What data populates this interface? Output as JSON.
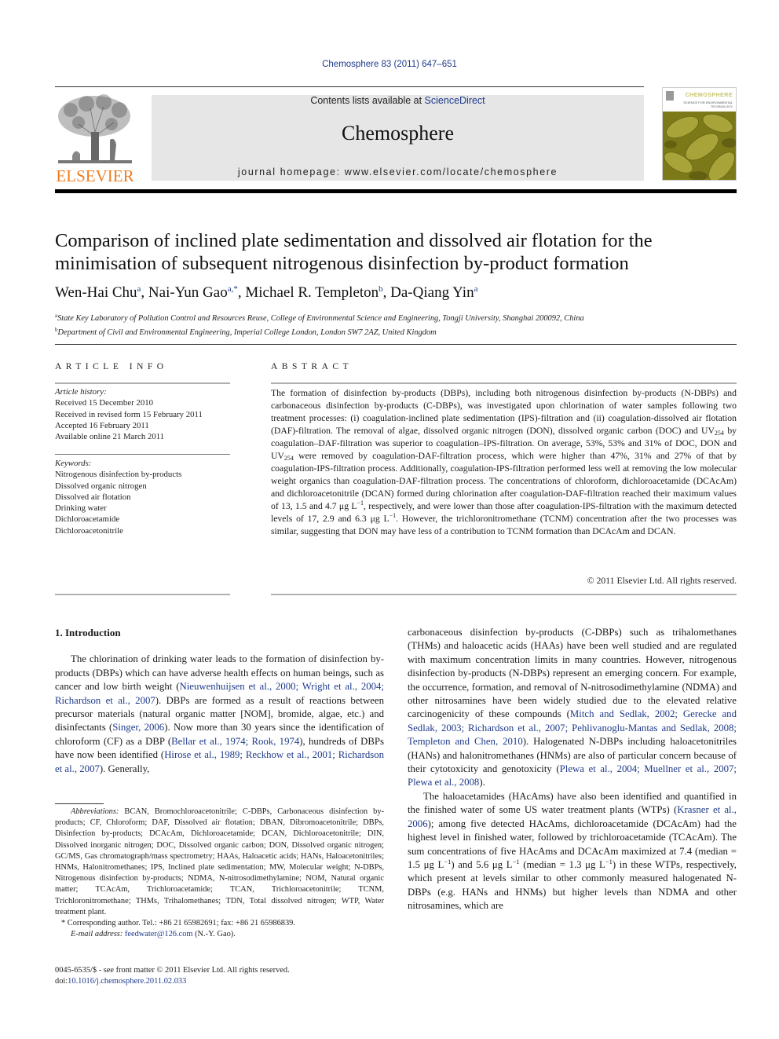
{
  "header": {
    "journal_ref": "Chemosphere 83 (2011) 647–651",
    "contents_prefix": "Contents lists available at ",
    "contents_link": "ScienceDirect",
    "journal_name": "Chemosphere",
    "homepage": "journal homepage: www.elsevier.com/locate/chemosphere",
    "publisher_logo_text": "ELSEVIER",
    "cover_title": "CHEMOSPHERE",
    "cover_subtitle": "SCIENCE FOR ENVIRONMENTAL TECHNOLOGY",
    "colors": {
      "publisher_orange": "#f07c1e",
      "link_blue": "#1f3a8a",
      "masthead_gray": "#e6e6e6",
      "cover_olive": "#8a8a1c"
    }
  },
  "article": {
    "title": "Comparison of inclined plate sedimentation and dissolved air flotation for the minimisation of subsequent nitrogenous disinfection by-product formation",
    "authors": [
      {
        "name": "Wen-Hai Chu",
        "sup": "a",
        "sep": ", "
      },
      {
        "name": "Nai-Yun Gao",
        "sup": "a,*",
        "sep": ", "
      },
      {
        "name": "Michael R. Templeton",
        "sup": "b",
        "sep": ", "
      },
      {
        "name": "Da-Qiang Yin",
        "sup": "a",
        "sep": ""
      }
    ],
    "affiliations": [
      {
        "mark": "a",
        "text": "State Key Laboratory of Pollution Control and Resources Reuse, College of Environmental Science and Engineering, Tongji University, Shanghai 200092, China"
      },
      {
        "mark": "b",
        "text": "Department of Civil and Environmental Engineering, Imperial College London, London SW7 2AZ, United Kingdom"
      }
    ]
  },
  "article_info": {
    "heading": "ARTICLE INFO",
    "history_label": "Article history:",
    "history": [
      "Received 15 December 2010",
      "Received in revised form 15 February 2011",
      "Accepted 16 February 2011",
      "Available online 21 March 2011"
    ],
    "keywords_label": "Keywords:",
    "keywords": [
      "Nitrogenous disinfection by-products",
      "Dissolved organic nitrogen",
      "Dissolved air flotation",
      "Drinking water",
      "Dichloroacetamide",
      "Dichloroacetonitrile"
    ]
  },
  "abstract": {
    "heading": "ABSTRACT",
    "parts": {
      "p1": "The formation of disinfection by-products (DBPs), including both nitrogenous disinfection by-products (N-DBPs) and carbonaceous disinfection by-products (C-DBPs), was investigated upon chlorination of water samples following two treatment processes: (i) coagulation-inclined plate sedimentation (IPS)-filtration and (ii) coagulation-dissolved air flotation (DAF)-filtration. The removal of algae, dissolved organic nitrogen (DON), dissolved organic carbon (DOC) and UV",
      "sub1": "254",
      "p2": " by coagulation–DAF-filtration was superior to coagulation–IPS-filtration. On average, 53%, 53% and 31% of DOC, DON and UV",
      "sub2": "254",
      "p3": " were removed by coagulation-DAF-filtration process, which were higher than 47%, 31% and 27% of that by coagulation-IPS-filtration process. Additionally, coagulation-IPS-filtration performed less well at removing the low molecular weight organics than coagulation-DAF-filtration process. The concentrations of chloroform, dichloroacetamide (DCAcAm) and dichloroacetonitrile (DCAN) formed during chlorination after coagulation-DAF-filtration reached their maximum values of 13, 1.5 and 4.7 μg L",
      "sup1": "−1",
      "p4": ", respectively, and were lower than those after coagulation-IPS-filtration with the maximum detected levels of 17, 2.9 and 6.3 μg L",
      "sup2": "−1",
      "p5": ". However, the trichloronitromethane (TCNM) concentration after the two processes was similar, suggesting that DON may have less of a contribution to TCNM formation than DCAcAm and DCAN."
    },
    "copyright": "© 2011 Elsevier Ltd. All rights reserved."
  },
  "body": {
    "intro_heading": "1. Introduction",
    "left_p1": {
      "t1": "The chlorination of drinking water leads to the formation of disinfection by-products (DBPs) which can have adverse health effects on human beings, such as cancer and low birth weight (",
      "c1": "Nieuwenhuijsen et al., 2000; Wright et al., 2004; Richardson et al., 2007",
      "t2": "). DBPs are formed as a result of reactions between precursor materials (natural organic matter [NOM], bromide, algae, etc.) and disinfectants (",
      "c2": "Singer, 2006",
      "t3": "). Now more than 30 years since the identification of chloroform (CF) as a DBP (",
      "c3": "Bellar et al., 1974; Rook, 1974",
      "t4": "), hundreds of DBPs have now been identified (",
      "c4": "Hirose et al., 1989; Reckhow et al., 2001; Richardson et al., 2007",
      "t5": "). Generally,"
    },
    "right_p1": {
      "t1": "carbonaceous disinfection by-products (C-DBPs) such as trihalomethanes (THMs) and haloacetic acids (HAAs) have been well studied and are regulated with maximum concentration limits in many countries. However, nitrogenous disinfection by-products (N-DBPs) represent an emerging concern. For example, the occurrence, formation, and removal of N-nitrosodimethylamine (NDMA) and other nitrosamines have been widely studied due to the elevated relative carcinogenicity of these compounds (",
      "c1": "Mitch and Sedlak, 2002; Gerecke and Sedlak, 2003; Richardson et al., 2007; Pehlivanoglu-Mantas and Sedlak, 2008; Templeton and Chen, 2010",
      "t2": "). Halogenated N-DBPs including haloacetonitriles (HANs) and halonitromethanes (HNMs) are also of particular concern because of their cytotoxicity and genotoxicity (",
      "c2": "Plewa et al., 2004; Muellner et al., 2007; Plewa et al., 2008",
      "t3": ")."
    },
    "right_p2": {
      "t1": "The haloacetamides (HAcAms) have also been identified and quantified in the finished water of some US water treatment plants (WTPs) (",
      "c1": "Krasner et al., 2006",
      "t2": "); among five detected HAcAms, dichloroacetamide (DCAcAm) had the highest level in finished water, followed by trichloroacetamide (TCAcAm). The sum concentrations of five HAcAms and DCAcAm maximized at 7.4 (median = 1.5 μg L",
      "s1": "−1",
      "t3": ") and 5.6 μg L",
      "s2": "−1",
      "t4": " (median = 1.3 μg L",
      "s3": "−1",
      "t5": ") in these WTPs, respectively, which present at levels similar to other commonly measured halogenated N-DBPs (e.g. HANs and HNMs) but higher levels than NDMA and other nitrosamines, which are"
    }
  },
  "footnotes": {
    "abbr_label": "Abbreviations:",
    "abbr_text": " BCAN, Bromochloroacetonitrile; C-DBPs, Carbonaceous disinfection by-products; CF, Chloroform; DAF, Dissolved air flotation; DBAN, Dibromoacetonitrile; DBPs, Disinfection by-products; DCAcAm, Dichloroacetamide; DCAN, Dichloroacetonitrile; DIN, Dissolved inorganic nitrogen; DOC, Dissolved organic carbon; DON, Dissolved organic nitrogen; GC/MS, Gas chromatograph/mass spectrometry; HAAs, Haloacetic acids; HANs, Haloacetonitriles; HNMs, Halonitromethanes; IPS, Inclined plate sedimentation; MW, Molecular weight; N-DBPs, Nitrogenous disinfection by-products; NDMA, N-nitrosodimethylamine; NOM, Natural organic matter; TCAcAm, Trichloroacetamide; TCAN, Trichloroacetonitrile; TCNM, Trichloronitromethane; THMs, Trihalomethanes; TDN, Total dissolved nitrogen; WTP, Water treatment plant.",
    "corresponding": "*  Corresponding author. Tel.: +86 21 65982691; fax: +86 21 65986839.",
    "email_label": "E-mail address: ",
    "email": "feedwater@126.com",
    "email_suffix": " (N.-Y. Gao).",
    "issn_line": "0045-6535/$ - see front matter © 2011 Elsevier Ltd. All rights reserved.",
    "doi_label": "doi:",
    "doi": "10.1016/j.chemosphere.2011.02.033"
  }
}
